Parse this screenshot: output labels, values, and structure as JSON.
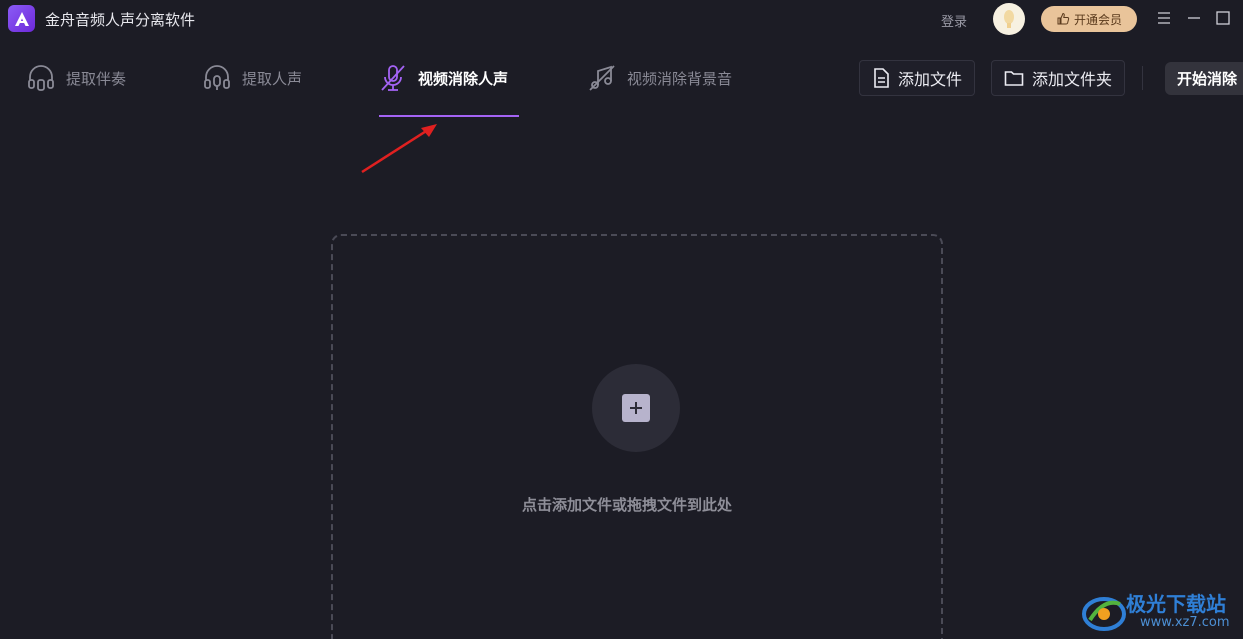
{
  "app": {
    "title": "金舟音频人声分离软件",
    "login_label": "登录",
    "vip_label": "开通会员"
  },
  "tabs": [
    {
      "label": "提取伴奏",
      "icon": "headphone-icon",
      "active": false
    },
    {
      "label": "提取人声",
      "icon": "headphone-mic-icon",
      "active": false
    },
    {
      "label": "视频消除人声",
      "icon": "mic-off-icon",
      "active": true
    },
    {
      "label": "视频消除背景音",
      "icon": "music-off-icon",
      "active": false
    }
  ],
  "actions": {
    "add_file_label": "添加文件",
    "add_folder_label": "添加文件夹",
    "start_label": "开始消除"
  },
  "dropzone": {
    "hint": "点击添加文件或拖拽文件到此处"
  },
  "watermark": {
    "name": "极光下载站",
    "url": "www.xz7.com"
  },
  "colors": {
    "background": "#1c1c25",
    "accent": "#a463f5",
    "vip": "#e9c49a",
    "annotation_arrow": "#e02020"
  }
}
